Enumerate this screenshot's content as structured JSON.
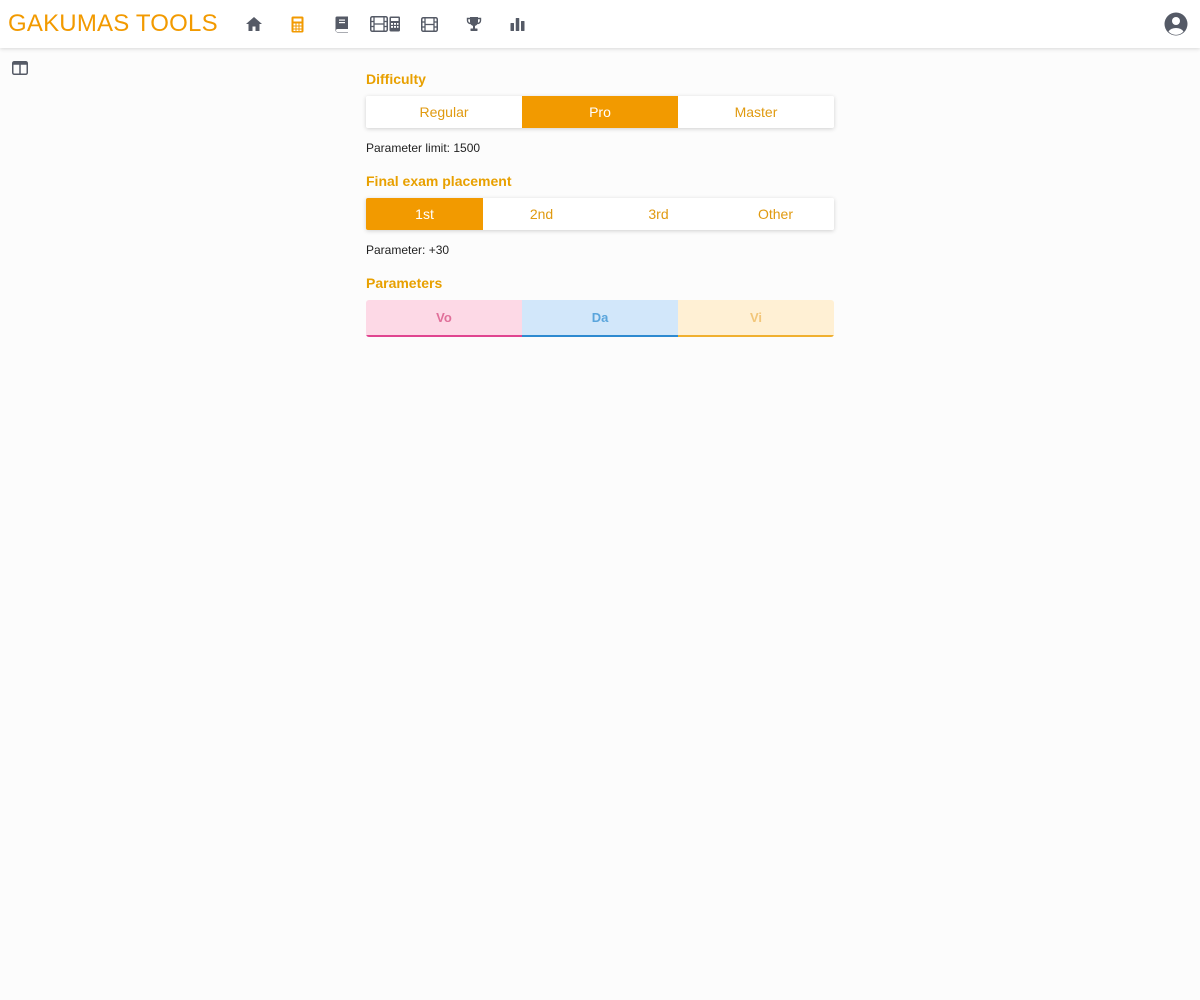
{
  "app": {
    "brand": "GAKUMAS TOOLS"
  },
  "nav": {
    "icons": [
      "home-icon",
      "calculator-icon",
      "book-icon",
      "film-grid-icon",
      "film-icon",
      "trophy-icon",
      "bar-chart-icon"
    ],
    "active": "calculator-icon"
  },
  "difficulty": {
    "title": "Difficulty",
    "options": [
      "Regular",
      "Pro",
      "Master"
    ],
    "selected": "Pro",
    "info": "Parameter limit: 1500"
  },
  "placement": {
    "title": "Final exam placement",
    "options": [
      "1st",
      "2nd",
      "3rd",
      "Other"
    ],
    "selected": "1st",
    "info": "Parameter: +30"
  },
  "parameters": {
    "title": "Parameters",
    "items": [
      {
        "label": "Vo",
        "color": "#e04590"
      },
      {
        "label": "Da",
        "color": "#2e8ad0"
      },
      {
        "label": "Vi",
        "color": "#f0b030"
      }
    ]
  },
  "colors": {
    "accent": "#f29a00",
    "icon": "#555a66"
  }
}
